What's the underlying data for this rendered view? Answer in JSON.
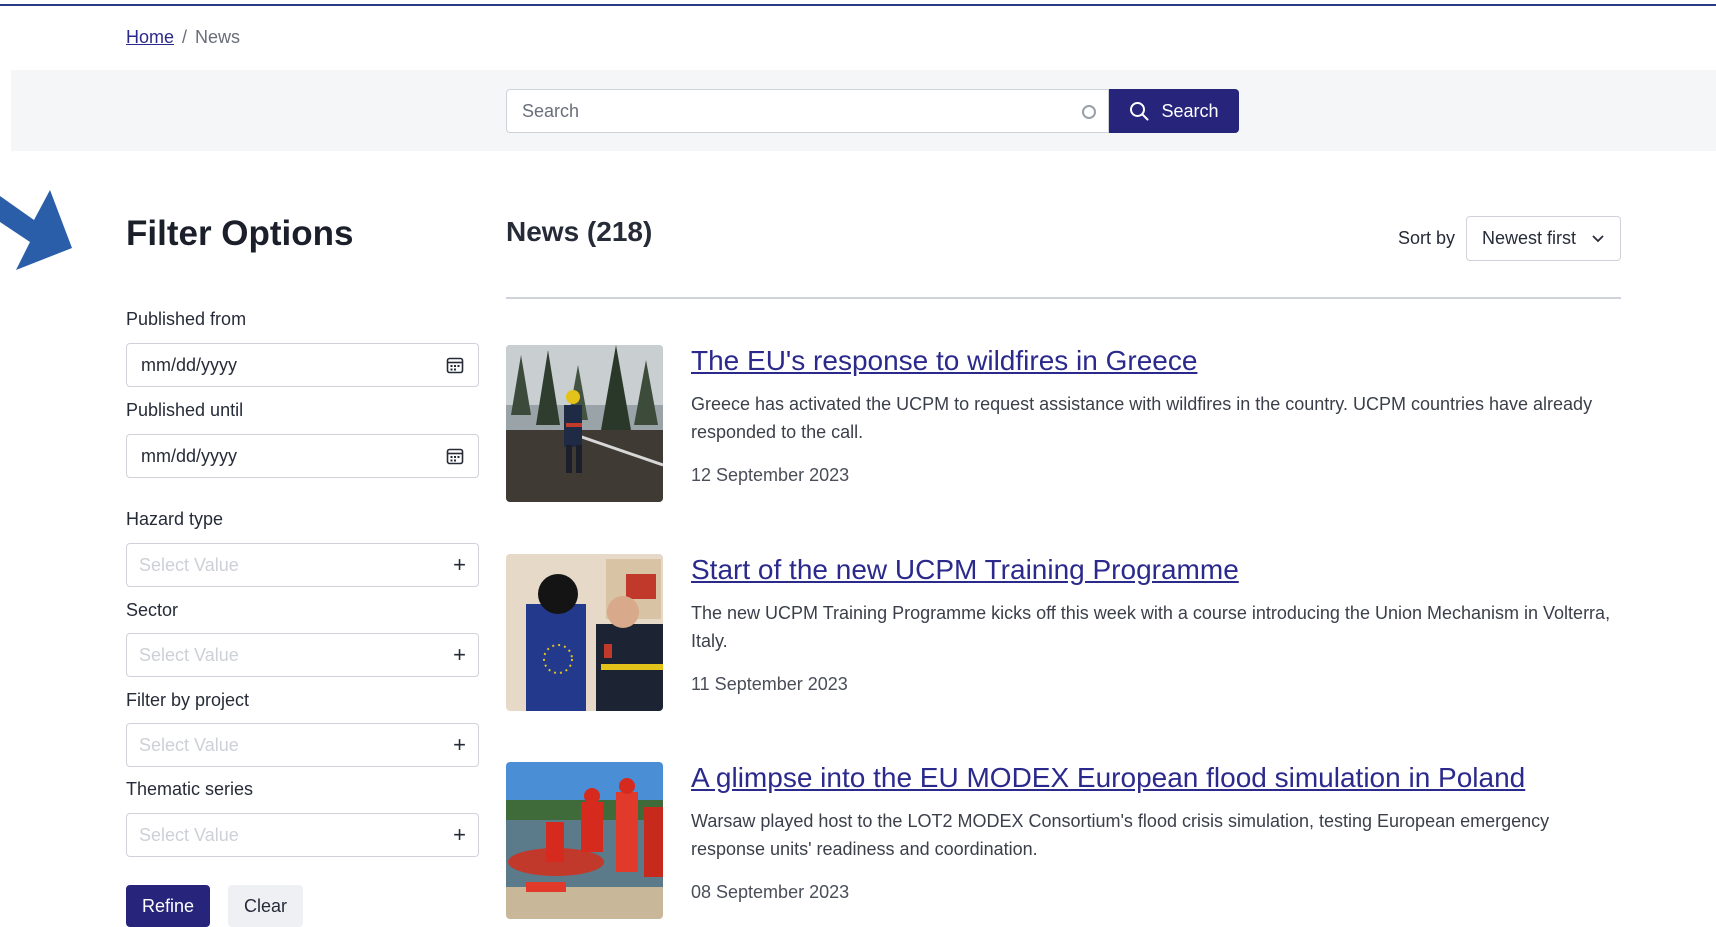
{
  "breadcrumb": {
    "home": "Home",
    "separator": "/",
    "current": "News"
  },
  "search": {
    "placeholder": "Search",
    "button_label": "Search"
  },
  "filters": {
    "title": "Filter Options",
    "published_from": {
      "label": "Published from",
      "placeholder": "mm/dd/yyyy"
    },
    "published_until": {
      "label": "Published until",
      "placeholder": "mm/dd/yyyy"
    },
    "hazard_type": {
      "label": "Hazard type",
      "placeholder": "Select Value"
    },
    "sector": {
      "label": "Sector",
      "placeholder": "Select Value"
    },
    "project": {
      "label": "Filter by project",
      "placeholder": "Select Value"
    },
    "thematic_series": {
      "label": "Thematic series",
      "placeholder": "Select Value"
    },
    "refine_label": "Refine",
    "clear_label": "Clear"
  },
  "news": {
    "heading": "News (218)",
    "sort_label": "Sort by",
    "sort_value": "Newest first",
    "items": [
      {
        "title": "The EU's response to wildfires in Greece",
        "description": "Greece has activated the UCPM to request assistance with wildfires in the country. UCPM countries have already responded to the call.",
        "date": "12 September 2023"
      },
      {
        "title": "Start of the new UCPM Training Programme",
        "description": "The new UCPM Training Programme kicks off this week with a course introducing the Union Mechanism in Volterra, Italy.",
        "date": "11 September 2023"
      },
      {
        "title": "A glimpse into the EU MODEX European flood simulation in Poland",
        "description": "Warsaw played host to the LOT2 MODEX Consortium's flood crisis simulation, testing European emergency response units' readiness and coordination.",
        "date": "08 September 2023"
      }
    ]
  },
  "colors": {
    "primary": "#26247b",
    "link": "#2b2a8c",
    "accent_arrow": "#2a5ea8"
  },
  "icons": [
    "search-icon",
    "calendar-icon",
    "plus-icon",
    "chevron-down-icon",
    "clear-circle-icon",
    "arrow-pointer-icon"
  ]
}
